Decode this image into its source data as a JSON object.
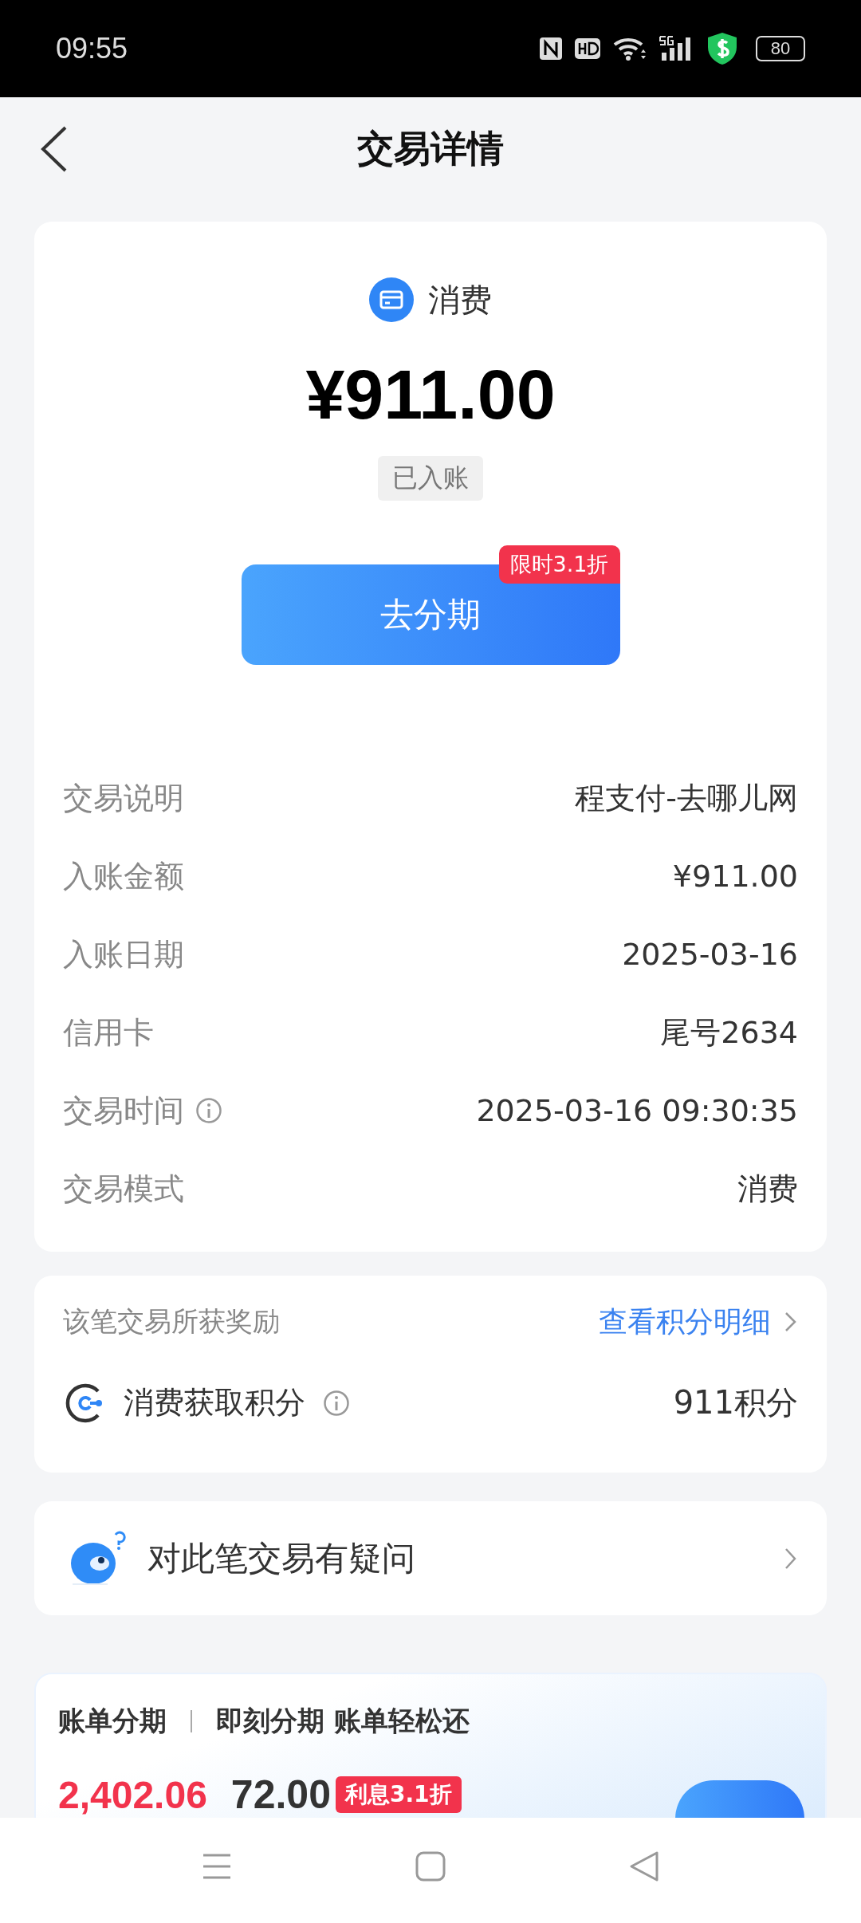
{
  "status_bar": {
    "time": "09:55",
    "battery": "80"
  },
  "header": {
    "title": "交易详情"
  },
  "summary": {
    "type_label": "消费",
    "amount": "¥911.00",
    "status": "已入账",
    "button": "去分期",
    "promo_badge": "限时3.1折"
  },
  "details": [
    {
      "label": "交易说明",
      "value": "程支付-去哪儿网",
      "info": false
    },
    {
      "label": "入账金额",
      "value": "¥911.00",
      "info": false
    },
    {
      "label": "入账日期",
      "value": "2025-03-16",
      "info": false
    },
    {
      "label": "信用卡",
      "value": "尾号2634",
      "info": false
    },
    {
      "label": "交易时间",
      "value": "2025-03-16 09:30:35",
      "info": true
    },
    {
      "label": "交易模式",
      "value": "消费",
      "info": false
    }
  ],
  "rewards": {
    "title": "该笔交易所获奖励",
    "link": "查看积分明细",
    "item_label": "消费获取积分",
    "item_value": "911积分"
  },
  "question": {
    "label": "对此笔交易有疑问"
  },
  "installment": {
    "title": "账单分期",
    "subtitle": "即刻分期 账单轻松还",
    "amount": "2,402.06",
    "fee": "72.00",
    "badge": "利息3.1折"
  }
}
